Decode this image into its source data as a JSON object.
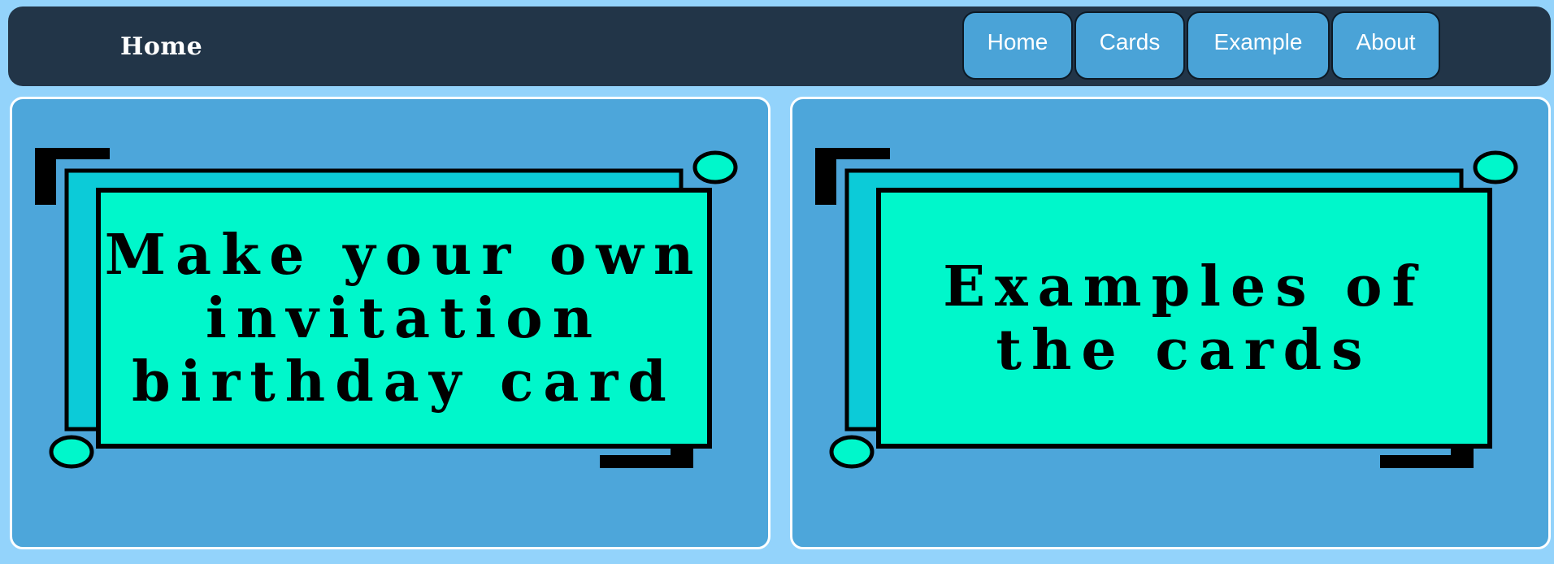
{
  "navbar": {
    "brand": "Home",
    "links": [
      {
        "label": "Home"
      },
      {
        "label": "Cards"
      },
      {
        "label": "Example"
      },
      {
        "label": "About"
      }
    ]
  },
  "cards": [
    {
      "text": "Make your own invitation birthday card"
    },
    {
      "text": "Examples of the cards"
    }
  ],
  "colors": {
    "page_bg": "#93d3fb",
    "navbar_bg": "#223548",
    "nav_button": "#4aa3d7",
    "card_bg": "#4da6da",
    "panel_back": "#0ccbd8",
    "panel_front": "#00f7cb"
  }
}
